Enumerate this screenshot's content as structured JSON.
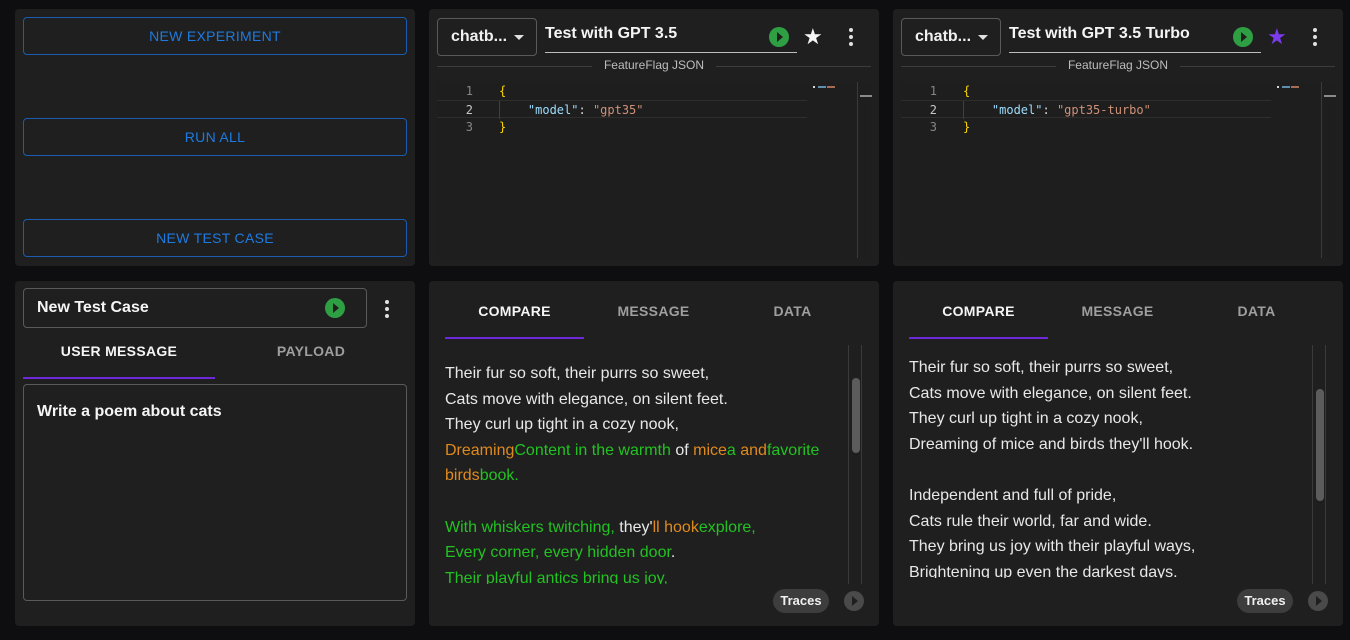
{
  "actions": {
    "new_experiment": "NEW EXPERIMENT",
    "run_all": "RUN ALL",
    "new_test_case": "NEW TEST CASE"
  },
  "colors": {
    "accent_blue": "#1f7ae0",
    "tab_indicator": "#6d28d9",
    "run_green": "#2ea043",
    "star_selected": "#7c3aed",
    "diff_removed": "#e08a1e",
    "diff_added": "#22c222"
  },
  "experiments": [
    {
      "model_select": "chatb...",
      "name": "Test with GPT 3.5",
      "starred": false,
      "divider_label": "FeatureFlag JSON",
      "code": {
        "line_numbers": [
          "1",
          "2",
          "3"
        ],
        "open_brace": "{",
        "key": "\"model\"",
        "colon": ": ",
        "value": "\"gpt35\"",
        "close_brace": "}"
      }
    },
    {
      "model_select": "chatb...",
      "name": "Test with GPT 3.5 Turbo",
      "starred": true,
      "divider_label": "FeatureFlag JSON",
      "code": {
        "line_numbers": [
          "1",
          "2",
          "3"
        ],
        "open_brace": "{",
        "key": "\"model\"",
        "colon": ": ",
        "value": "\"gpt35-turbo\"",
        "close_brace": "}"
      }
    }
  ],
  "test_case": {
    "name": "New Test Case",
    "tabs": [
      "USER MESSAGE",
      "PAYLOAD"
    ],
    "active_tab": "USER MESSAGE",
    "message": "Write a poem about cats"
  },
  "results": [
    {
      "tabs": [
        "COMPARE",
        "MESSAGE",
        "DATA"
      ],
      "active_tab": "COMPARE",
      "traces_label": "Traces",
      "scroll_position": 0.2,
      "lines": [
        [
          {
            "t": "Their fur so soft, their purrs so sweet,",
            "k": "same"
          }
        ],
        [
          {
            "t": "Cats move with elegance, on silent feet.",
            "k": "same"
          }
        ],
        [
          {
            "t": "They curl up tight in a cozy nook,",
            "k": "same"
          }
        ],
        [
          {
            "t": "Dreaming",
            "k": "del"
          },
          {
            "t": "Content in the warmth",
            "k": "add"
          },
          {
            "t": " of ",
            "k": "same"
          },
          {
            "t": "mice",
            "k": "del"
          },
          {
            "t": "a ",
            "k": "add"
          },
          {
            "t": "and",
            "k": "del"
          },
          {
            "t": "favorite",
            "k": "add"
          }
        ],
        [
          {
            "t": "birds",
            "k": "del"
          },
          {
            "t": "book.",
            "k": "add"
          }
        ],
        [],
        [
          {
            "t": "With whiskers twitching, ",
            "k": "add"
          },
          {
            "t": "they'",
            "k": "same"
          },
          {
            "t": "ll hook",
            "k": "del"
          },
          {
            "t": "explore,",
            "k": "add"
          }
        ],
        [
          {
            "t": "Every corner, every hidden door",
            "k": "add"
          },
          {
            "t": ".",
            "k": "same"
          }
        ],
        [
          {
            "t": "Their playful antics bring us joy,",
            "k": "add"
          }
        ]
      ]
    },
    {
      "tabs": [
        "COMPARE",
        "MESSAGE",
        "DATA"
      ],
      "active_tab": "COMPARE",
      "traces_label": "Traces",
      "scroll_position": 0.35,
      "lines": [
        [
          {
            "t": "Their fur so soft, their purrs so sweet,",
            "k": "same"
          }
        ],
        [
          {
            "t": "Cats move with elegance, on silent feet.",
            "k": "same"
          }
        ],
        [
          {
            "t": "They curl up tight in a cozy nook,",
            "k": "same"
          }
        ],
        [
          {
            "t": "Dreaming of mice and birds they'll hook.",
            "k": "same"
          }
        ],
        [],
        [
          {
            "t": "Independent and full of pride,",
            "k": "same"
          }
        ],
        [
          {
            "t": "Cats rule their world, far and wide.",
            "k": "same"
          }
        ],
        [
          {
            "t": "They bring us joy with their playful ways,",
            "k": "same"
          }
        ],
        [
          {
            "t": "Brightening up even the darkest days.",
            "k": "same"
          }
        ]
      ]
    }
  ]
}
